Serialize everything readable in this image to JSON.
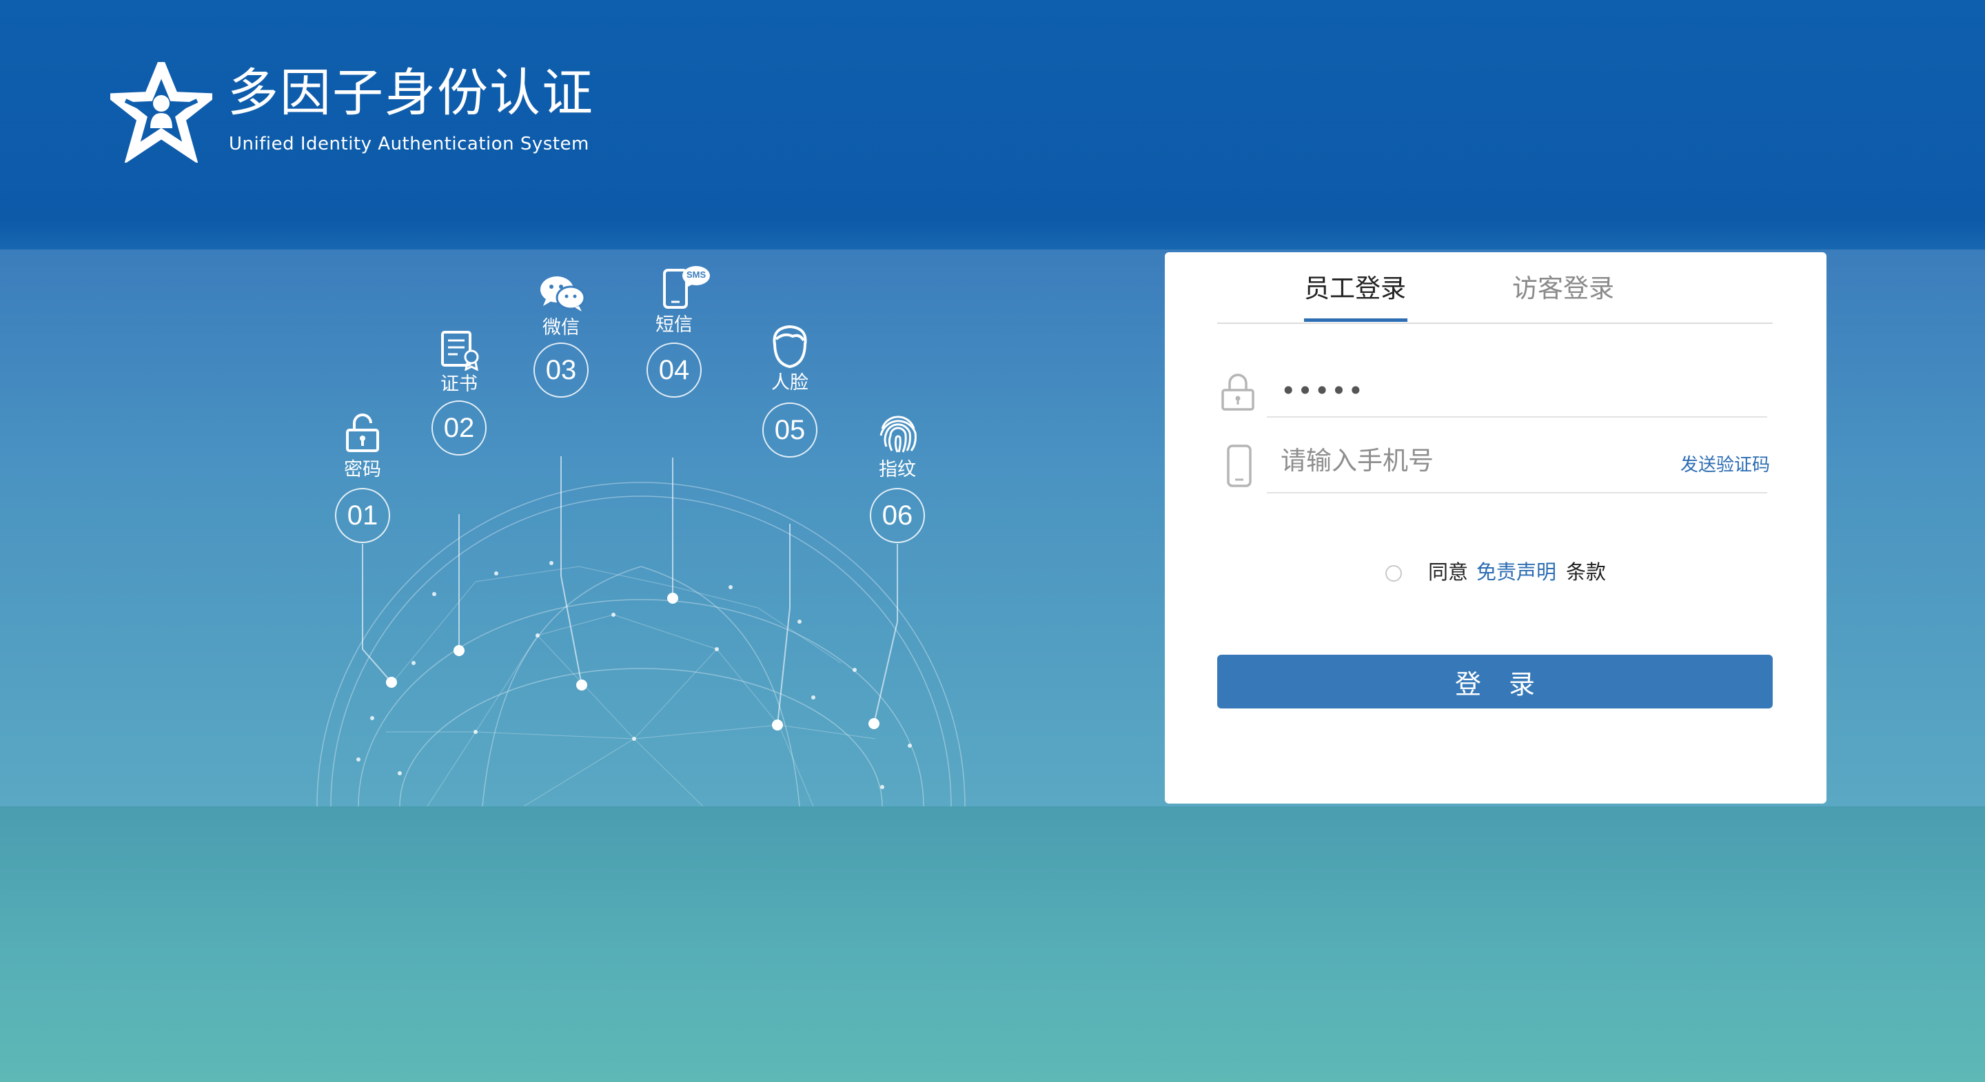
{
  "header": {
    "title": "多因子身份认证",
    "subtitle": "Unified Identity Authentication System"
  },
  "factors": [
    {
      "num": "01",
      "label": "密码",
      "icon": "lock-icon"
    },
    {
      "num": "02",
      "label": "证书",
      "icon": "certificate-icon"
    },
    {
      "num": "03",
      "label": "微信",
      "icon": "wechat-icon"
    },
    {
      "num": "04",
      "label": "短信",
      "icon": "sms-phone-icon"
    },
    {
      "num": "05",
      "label": "人脸",
      "icon": "face-icon"
    },
    {
      "num": "06",
      "label": "指纹",
      "icon": "fingerprint-icon"
    }
  ],
  "sms_badge": "SMS",
  "login": {
    "tabs": [
      {
        "label": "员工登录",
        "active": true
      },
      {
        "label": "访客登录",
        "active": false
      }
    ],
    "password_value": "•••••",
    "phone_placeholder": "请输入手机号",
    "send_code_label": "发送验证码",
    "agree_prefix": "同意",
    "agree_link": "免责声明",
    "agree_suffix": "条款",
    "submit_label": "登 录"
  },
  "colors": {
    "header_bg": "#0e5fae",
    "accent": "#2c6db3",
    "button_bg": "#3779b8",
    "bottom_bg": "#5db8b6"
  }
}
